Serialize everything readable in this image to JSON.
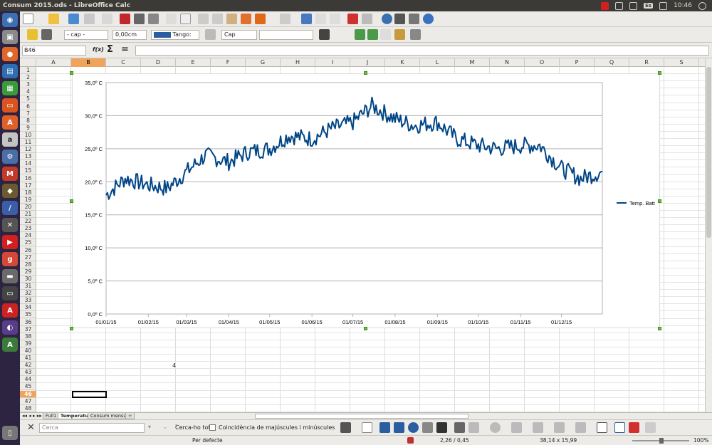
{
  "window": {
    "title": "Consum 2015.ods - LibreOffice Calc"
  },
  "tray": {
    "keyboard_layout": "Es",
    "time": "10:46"
  },
  "toolbar2": {
    "paragraph_style": "- cap -",
    "line_width": "0,00cm",
    "color_name": "Tango:",
    "arrow_style": "Cap"
  },
  "formula": {
    "name_box": "B46",
    "fx_label": "f(x)",
    "sum_label": "Σ",
    "equals_label": "="
  },
  "columns": [
    "A",
    "B",
    "C",
    "D",
    "E",
    "F",
    "G",
    "H",
    "I",
    "J",
    "K",
    "L",
    "M",
    "N",
    "O",
    "P",
    "Q",
    "R",
    "S"
  ],
  "active_column": "B",
  "rows": [
    1,
    2,
    3,
    4,
    5,
    6,
    7,
    8,
    9,
    10,
    11,
    12,
    13,
    14,
    15,
    16,
    17,
    18,
    19,
    20,
    21,
    22,
    23,
    24,
    25,
    26,
    27,
    28,
    29,
    30,
    31,
    32,
    33,
    34,
    35,
    36,
    37,
    38,
    39,
    40,
    41,
    42,
    43,
    44,
    45,
    46,
    47,
    48
  ],
  "active_row": 46,
  "cell_d42": "4",
  "sheet_tabs": [
    {
      "label": "Full1",
      "active": false
    },
    {
      "label": "Temperatura",
      "active": true
    },
    {
      "label": "Consum mensual",
      "active": false
    }
  ],
  "findbar": {
    "search_placeholder": "Cerca",
    "find_all_label": "Cerca-ho tot",
    "match_case_label": "Coincidència de majúscules i minúscules"
  },
  "status": {
    "page_style": "Per defecte",
    "position": "2,26 / 0,45",
    "size": "38,14 x 15,99",
    "zoom": "100%"
  },
  "chart_data": {
    "type": "line",
    "title": "",
    "xlabel": "",
    "ylabel": "",
    "ylim": [
      0,
      35
    ],
    "y_ticks": [
      "0,0º C",
      "5,0º C",
      "10,0º C",
      "15,0º C",
      "20,0º C",
      "25,0º C",
      "30,0º C",
      "35,0º C"
    ],
    "x_ticks": [
      "01/01/15",
      "01/02/15",
      "01/03/15",
      "01/04/15",
      "01/05/15",
      "01/06/15",
      "01/07/15",
      "01/08/15",
      "01/09/15",
      "01/10/15",
      "01/11/15",
      "01/12/15"
    ],
    "grid": true,
    "legend_position": "right",
    "series": [
      {
        "name": "Temp. Batt",
        "color": "#004586",
        "monthly_points": [
          {
            "x": "01/01/15",
            "y": 18.0
          },
          {
            "x": "15/01/15",
            "y": 20.5
          },
          {
            "x": "01/02/15",
            "y": 19.5
          },
          {
            "x": "15/02/15",
            "y": 19.0
          },
          {
            "x": "01/03/15",
            "y": 21.5
          },
          {
            "x": "15/03/15",
            "y": 24.0
          },
          {
            "x": "01/04/15",
            "y": 23.0
          },
          {
            "x": "15/04/15",
            "y": 24.5
          },
          {
            "x": "01/05/15",
            "y": 25.0
          },
          {
            "x": "15/05/15",
            "y": 27.0
          },
          {
            "x": "01/06/15",
            "y": 26.5
          },
          {
            "x": "15/06/15",
            "y": 28.0
          },
          {
            "x": "01/07/15",
            "y": 29.0
          },
          {
            "x": "15/07/15",
            "y": 31.5
          },
          {
            "x": "01/08/15",
            "y": 29.5
          },
          {
            "x": "15/08/15",
            "y": 28.5
          },
          {
            "x": "01/09/15",
            "y": 29.0
          },
          {
            "x": "15/09/15",
            "y": 26.5
          },
          {
            "x": "01/10/15",
            "y": 25.5
          },
          {
            "x": "15/10/15",
            "y": 25.0
          },
          {
            "x": "01/11/15",
            "y": 25.5
          },
          {
            "x": "15/11/15",
            "y": 25.5
          },
          {
            "x": "01/12/15",
            "y": 22.0
          },
          {
            "x": "15/12/15",
            "y": 20.5
          },
          {
            "x": "31/12/15",
            "y": 21.5
          }
        ]
      }
    ]
  }
}
